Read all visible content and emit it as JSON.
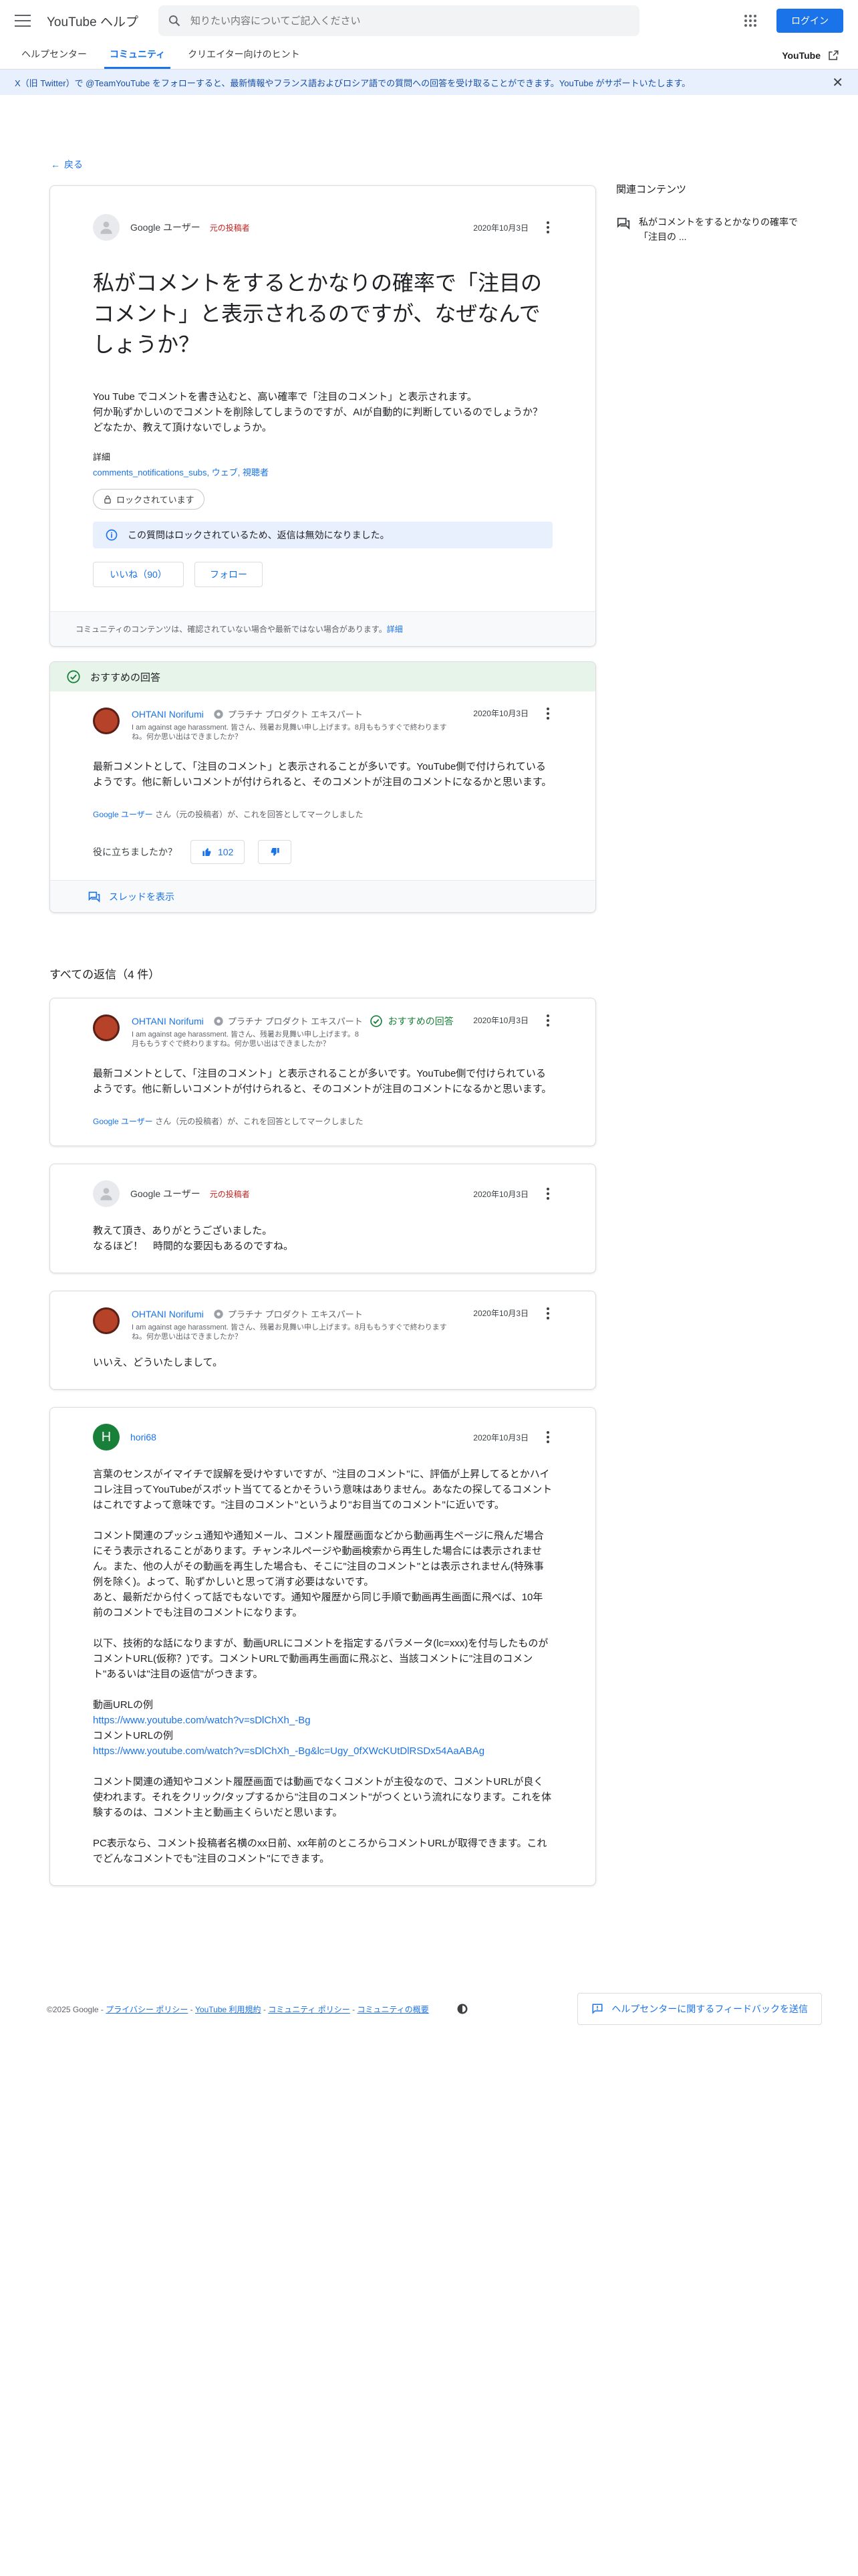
{
  "header": {
    "app_title": "YouTube ヘルプ",
    "search_placeholder": "知りたい内容についてご記入ください",
    "login_label": "ログイン"
  },
  "nav": {
    "tabs": [
      "ヘルプセンター",
      "コミュニティ",
      "クリエイター向けのヒント"
    ],
    "right_label": "YouTube"
  },
  "banner": {
    "text": "X（旧 Twitter）で @TeamYouTube をフォローすると、最新情報やフランス語およびロシア語での質問への回答を受け取ることができます。YouTube がサポートいたします。"
  },
  "back_label": "戻る",
  "question": {
    "author": "Google ユーザー",
    "op_badge": "元の投稿者",
    "date": "2020年10月3日",
    "title": "私がコメントをするとかなりの確率で「注目のコメント」と表示されるのですが、なぜなんでしょうか？",
    "body": "You Tube でコメントを書き込むと、高い確率で「注目のコメント」と表示されます。\n何か恥ずかしいのでコメントを削除してしまうのですが、AIが自動的に判断しているのでしょうか？\nどなたか、教えて頂けないでしょうか。",
    "detail_label": "詳細",
    "detail_links": "comments_notifications_subs, ウェブ, 視聴者",
    "locked_label": "ロックされています",
    "notice": "この質問はロックされているため、返信は無効になりました。",
    "like_label": "いいね（90）",
    "follow_label": "フォロー",
    "disclaimer": "コミュニティのコンテンツは、確認されていない場合や最新ではない場合があります。",
    "disclaimer_link": "詳細"
  },
  "recommended": {
    "heading": "おすすめの回答",
    "author": "OHTANI Norifumi",
    "level": "プラチナ プロダクト エキスパート",
    "signature": "I am against age harassment. 皆さん、残暑お見舞い申し上げます。8月ももうすぐで終わりますね。何か思い出はできましたか？",
    "date": "2020年10月3日",
    "text": "最新コメントとして、「注目のコメント」と表示されることが多いです。YouTube側で付けられているようです。他に新しいコメントが付けられると、そのコメントが注目のコメントになるかと思います。",
    "marked_user": "Google ユーザー",
    "marked_text": " さん（元の投稿者）が、これを回答としてマークしました",
    "helpful_label": "役に立ちましたか？",
    "up_count": "102",
    "thread_label": "スレッドを表示"
  },
  "all_replies_label": "すべての返信（4 件）",
  "replies": [
    {
      "author": "OHTANI Norifumi",
      "level": "プラチナ プロダクト エキスパート",
      "signature": "I am against age harassment. 皆さん、残暑お見舞い申し上げます。8月ももうすぐで終わりますね。何か思い出はできましたか？",
      "rec_badge": "おすすめの回答",
      "date": "2020年10月3日",
      "text": "最新コメントとして、「注目のコメント」と表示されることが多いです。YouTube側で付けられているようです。他に新しいコメントが付けられると、そのコメントが注目のコメントになるかと思います。",
      "marked_user": "Google ユーザー",
      "marked_text": " さん（元の投稿者）が、これを回答としてマークしました"
    },
    {
      "author": "Google ユーザー",
      "op_badge": "元の投稿者",
      "date": "2020年10月3日",
      "text": "教えて頂き、ありがとうございました。\nなるほど！　時間的な要因もあるのですね。"
    },
    {
      "author": "OHTANI Norifumi",
      "level": "プラチナ プロダクト エキスパート",
      "signature": "I am against age harassment. 皆さん、残暑お見舞い申し上げます。8月ももうすぐで終わりますね。何か思い出はできましたか？",
      "date": "2020年10月3日",
      "text": "いいえ、どういたしまして。"
    },
    {
      "author": "hori68",
      "avatar_letter": "H",
      "date": "2020年10月3日",
      "p1": "言葉のセンスがイマイチで誤解を受けやすいですが、\"注目のコメント\"に、評価が上昇してるとかハイコレ注目ってYouTubeがスポット当ててるとかそういう意味はありません。あなたの探してるコメントはこれですよって意味です。\"注目のコメント\"というより\"お目当てのコメント\"に近いです。",
      "p2": "コメント関連のプッシュ通知や通知メール、コメント履歴画面などから動画再生ページに飛んだ場合にそう表示されることがあります。チャンネルページや動画検索から再生した場合には表示されません。また、他の人がその動画を再生した場合も、そこに\"注目のコメント\"とは表示されません(特殊事例を除く)。よって、恥ずかしいと思って消す必要はないです。\nあと、最新だから付くって話でもないです。通知や履歴から同じ手順で動画再生画面に飛べば、10年前のコメントでも注目のコメントになります。",
      "p3": "以下、技術的な話になりますが、動画URLにコメントを指定するパラメータ(lc=xxx)を付与したものがコメントURL(仮称？)です。コメントURLで動画再生画面に飛ぶと、当該コメントに\"注目のコメント\"あるいは\"注目の返信\"がつきます。",
      "video_url_label": "動画URLの例",
      "video_url": "https://www.youtube.com/watch?v=sDlChXh_-Bg",
      "comment_url_label": "コメントURLの例",
      "comment_url": "https://www.youtube.com/watch?v=sDlChXh_-Bg&lc=Ugy_0fXWcKUtDlRSDx54AaABAg",
      "p4": "コメント関連の通知やコメント履歴画面では動画でなくコメントが主役なので、コメントURLが良く使われます。それをクリック/タップするから\"注目のコメント\"がつくという流れになります。これを体験するのは、コメント主と動画主くらいだと思います。",
      "p5": "PC表示なら、コメント投稿者名横のxx日前、xx年前のところからコメントURLが取得できます。これでどんなコメントでも\"注目のコメント\"にできます。"
    }
  ],
  "sidebar": {
    "title": "関連コンテンツ",
    "related": "私がコメントをするとかなりの確率で「注目の ..."
  },
  "footer": {
    "copyright": "©2025 Google - ",
    "links": [
      "プライバシー ポリシー",
      "YouTube 利用規約",
      "コミュニティ ポリシー",
      "コミュニティの概要"
    ],
    "feedback_label": "ヘルプセンターに関するフィードバックを送信"
  },
  "colors": {
    "accent": "#1a73e8",
    "recommend_bg": "#e6f4ea",
    "op_badge": "#c5221f",
    "success": "#188038"
  }
}
